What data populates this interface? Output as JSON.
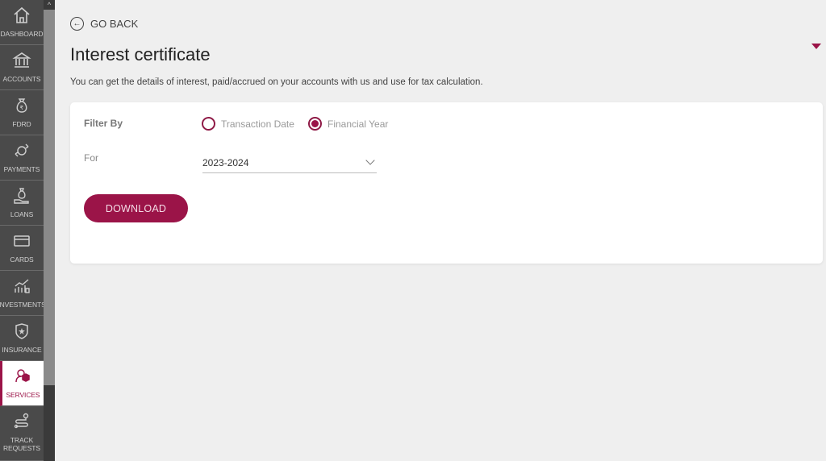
{
  "sidebar": {
    "items": [
      {
        "label": "DASHBOARD",
        "icon": "home-icon"
      },
      {
        "label": "ACCOUNTS",
        "icon": "bank-icon"
      },
      {
        "label": "FDRD",
        "icon": "money-bag-icon"
      },
      {
        "label": "PAYMENTS",
        "icon": "payments-icon"
      },
      {
        "label": "LOANS",
        "icon": "loan-icon"
      },
      {
        "label": "CARDS",
        "icon": "card-icon"
      },
      {
        "label": "INVESTMENTS",
        "icon": "investments-icon"
      },
      {
        "label": "INSURANCE",
        "icon": "shield-icon"
      },
      {
        "label": "SERVICES",
        "icon": "services-icon",
        "active": true
      },
      {
        "label": "TRACK REQUESTS",
        "icon": "track-icon"
      }
    ]
  },
  "header": {
    "go_back": "GO BACK",
    "title": "Interest certificate",
    "subtitle": "You can get the details of interest, paid/accrued on your accounts with us and use for tax calculation."
  },
  "form": {
    "filter_label": "Filter By",
    "options": [
      {
        "label": "Transaction Date",
        "selected": false
      },
      {
        "label": "Financial Year",
        "selected": true
      }
    ],
    "for_label": "For",
    "year_value": "2023-2024",
    "download_label": "DOWNLOAD"
  },
  "colors": {
    "accent": "#9b1448",
    "sidebar_bg": "#4a4a4a",
    "page_bg": "#efefef"
  }
}
